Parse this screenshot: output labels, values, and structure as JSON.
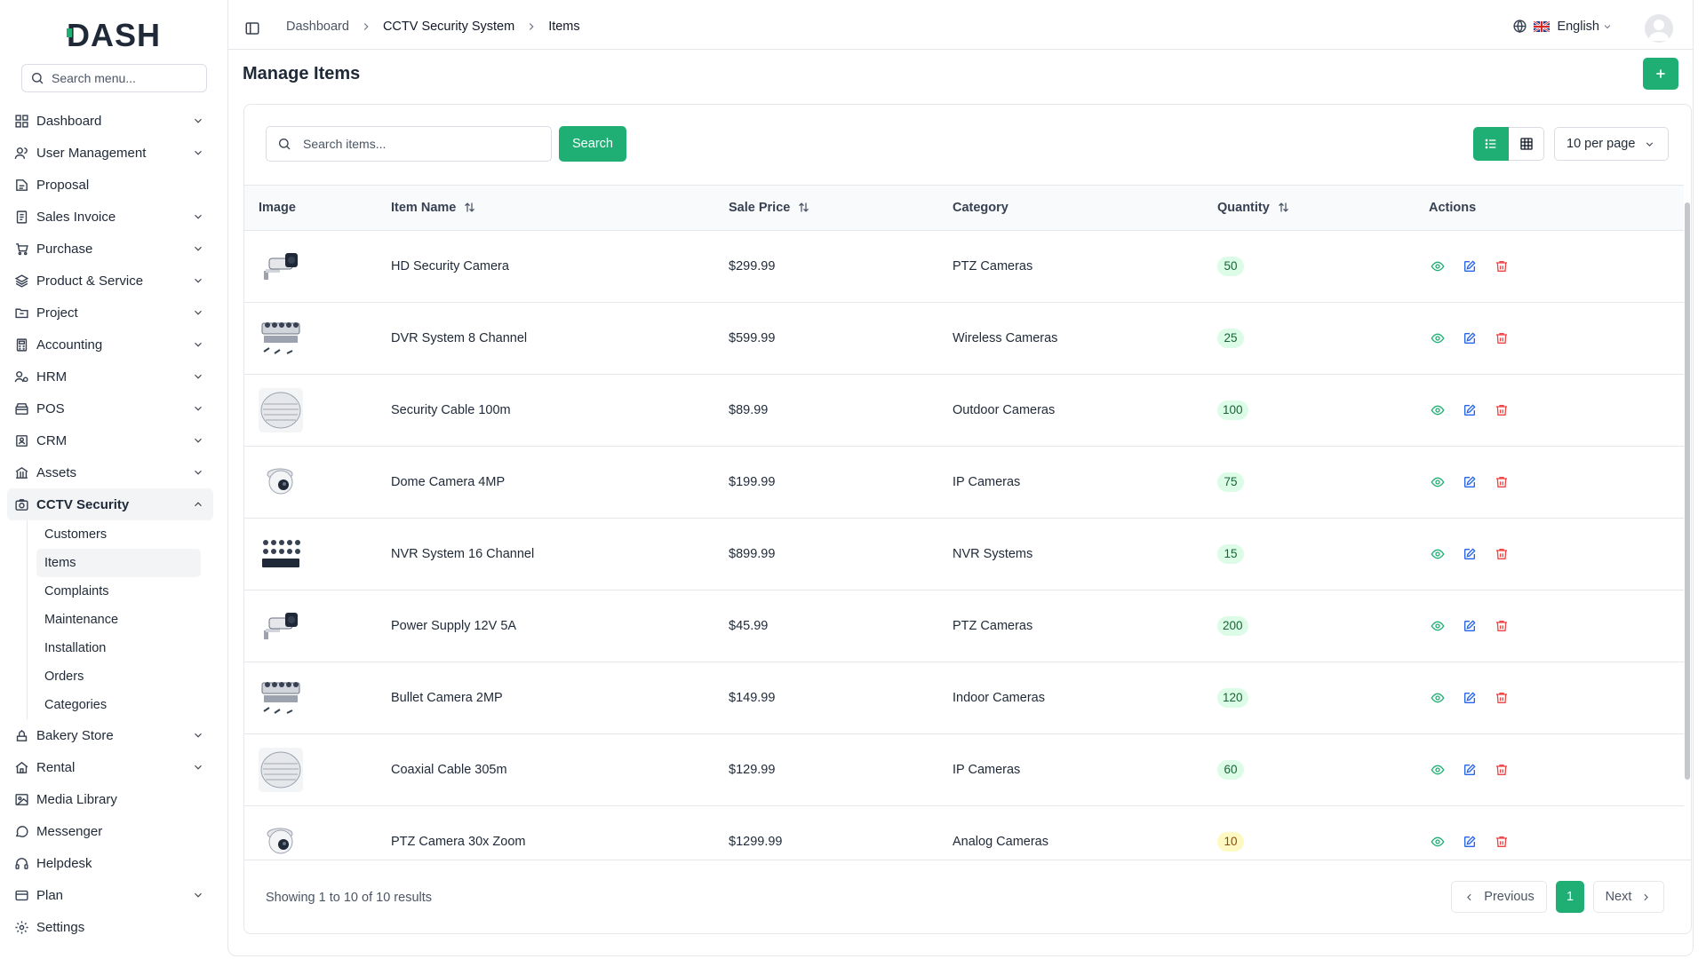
{
  "brand": {
    "logo_text": "DASH",
    "accent": "#1fae74"
  },
  "sidebar": {
    "search_placeholder": "Search menu...",
    "items": [
      {
        "label": "Dashboard",
        "icon": "dashboard-icon",
        "expandable": true
      },
      {
        "label": "User Management",
        "icon": "users-icon",
        "expandable": true
      },
      {
        "label": "Proposal",
        "icon": "proposal-icon",
        "expandable": false
      },
      {
        "label": "Sales Invoice",
        "icon": "invoice-icon",
        "expandable": true
      },
      {
        "label": "Purchase",
        "icon": "cart-icon",
        "expandable": true
      },
      {
        "label": "Product & Service",
        "icon": "layers-icon",
        "expandable": true
      },
      {
        "label": "Project",
        "icon": "folder-icon",
        "expandable": true
      },
      {
        "label": "Accounting",
        "icon": "calculator-icon",
        "expandable": true
      },
      {
        "label": "HRM",
        "icon": "hrm-icon",
        "expandable": true
      },
      {
        "label": "POS",
        "icon": "pos-icon",
        "expandable": true
      },
      {
        "label": "CRM",
        "icon": "crm-icon",
        "expandable": true
      },
      {
        "label": "Assets",
        "icon": "assets-icon",
        "expandable": true
      },
      {
        "label": "CCTV Security",
        "icon": "camera-icon",
        "expandable": true,
        "active": true
      }
    ],
    "subitems": [
      "Customers",
      "Items",
      "Complaints",
      "Maintenance",
      "Installation",
      "Orders",
      "Categories"
    ],
    "active_subitem": "Items",
    "items_after": [
      {
        "label": "Bakery Store",
        "icon": "bakery-icon",
        "expandable": true
      },
      {
        "label": "Rental",
        "icon": "home-icon",
        "expandable": true
      },
      {
        "label": "Media Library",
        "icon": "image-icon",
        "expandable": false
      },
      {
        "label": "Messenger",
        "icon": "message-icon",
        "expandable": false
      },
      {
        "label": "Helpdesk",
        "icon": "headset-icon",
        "expandable": false
      },
      {
        "label": "Plan",
        "icon": "credit-card-icon",
        "expandable": true
      },
      {
        "label": "Settings",
        "icon": "gear-icon",
        "expandable": false
      }
    ]
  },
  "header": {
    "breadcrumb": [
      "Dashboard",
      "CCTV Security System",
      "Items"
    ],
    "language": "English"
  },
  "page": {
    "title": "Manage Items",
    "search_placeholder": "Search items...",
    "search_button": "Search",
    "per_page": "10 per page"
  },
  "table": {
    "columns": [
      "Image",
      "Item Name",
      "Sale Price",
      "Category",
      "Quantity",
      "Actions"
    ],
    "rows": [
      {
        "thumb": "bullet-camera",
        "name": "HD Security Camera",
        "price": "$299.99",
        "category": "PTZ Cameras",
        "qty": "50",
        "qty_status": "ok"
      },
      {
        "thumb": "dvr-kit",
        "name": "DVR System 8 Channel",
        "price": "$599.99",
        "category": "Wireless Cameras",
        "qty": "25",
        "qty_status": "ok"
      },
      {
        "thumb": "cable-coil",
        "name": "Security Cable 100m",
        "price": "$89.99",
        "category": "Outdoor Cameras",
        "qty": "100",
        "qty_status": "ok"
      },
      {
        "thumb": "dome-camera",
        "name": "Dome Camera 4MP",
        "price": "$199.99",
        "category": "IP Cameras",
        "qty": "75",
        "qty_status": "ok"
      },
      {
        "thumb": "nvr-kit",
        "name": "NVR System 16 Channel",
        "price": "$899.99",
        "category": "NVR Systems",
        "qty": "15",
        "qty_status": "ok"
      },
      {
        "thumb": "bullet-camera",
        "name": "Power Supply 12V 5A",
        "price": "$45.99",
        "category": "PTZ Cameras",
        "qty": "200",
        "qty_status": "ok"
      },
      {
        "thumb": "dvr-kit",
        "name": "Bullet Camera 2MP",
        "price": "$149.99",
        "category": "Indoor Cameras",
        "qty": "120",
        "qty_status": "ok"
      },
      {
        "thumb": "cable-coil",
        "name": "Coaxial Cable 305m",
        "price": "$129.99",
        "category": "IP Cameras",
        "qty": "60",
        "qty_status": "ok"
      },
      {
        "thumb": "dome-camera",
        "name": "PTZ Camera 30x Zoom",
        "price": "$1299.99",
        "category": "Analog Cameras",
        "qty": "10",
        "qty_status": "low"
      }
    ]
  },
  "footer": {
    "showing": "Showing 1 to 10 of 10 results",
    "previous": "Previous",
    "current_page": "1",
    "next": "Next"
  }
}
